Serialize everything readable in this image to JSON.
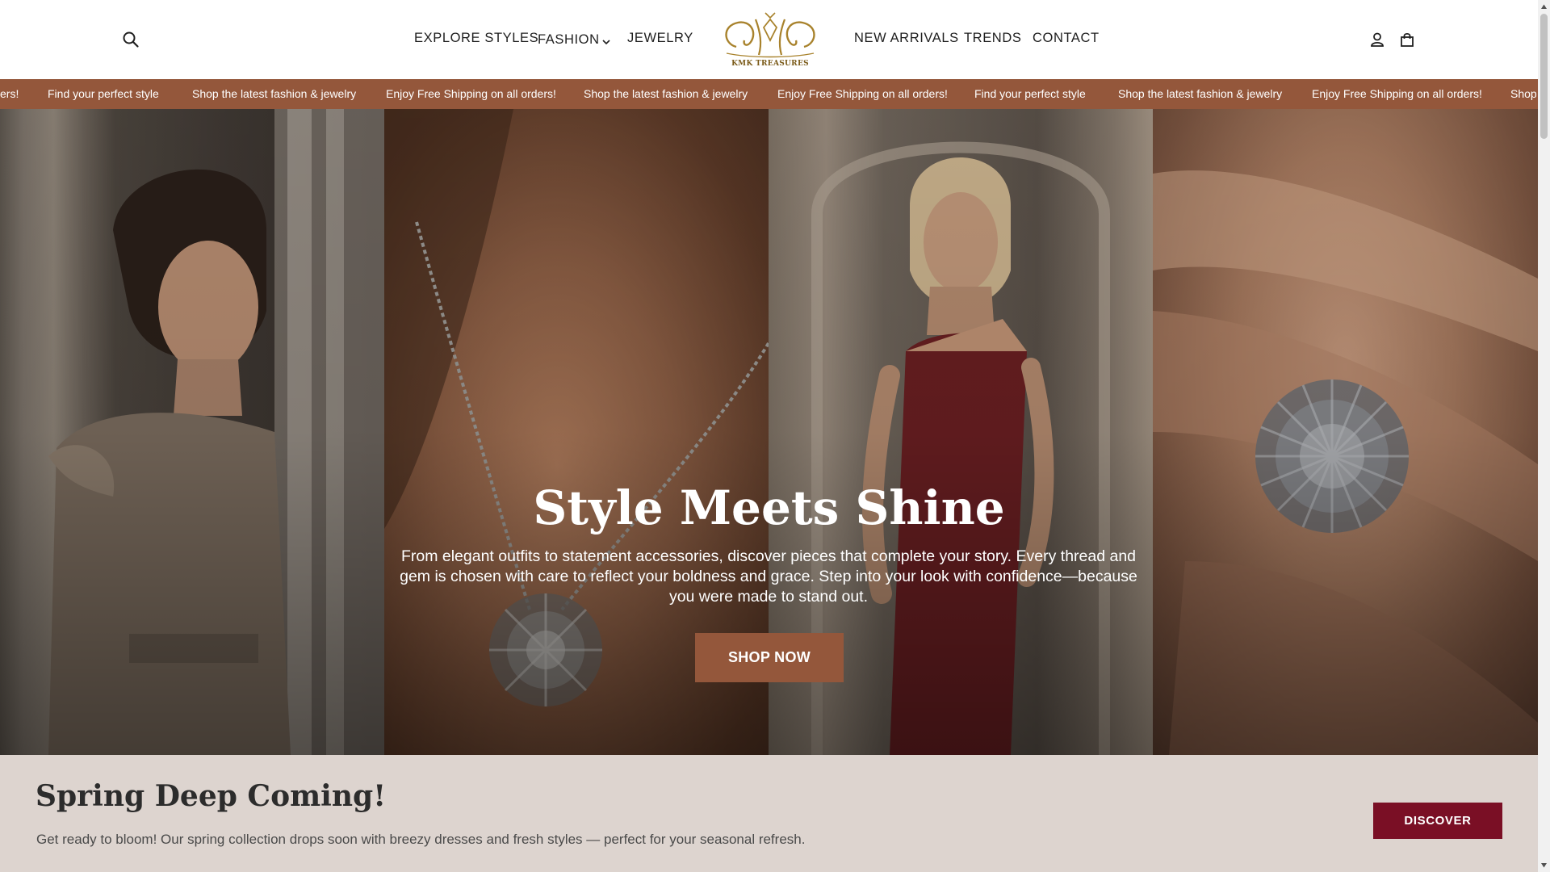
{
  "header": {
    "nav_left": [
      {
        "label": "EXPLORE STYLES"
      },
      {
        "label": "FASHION"
      },
      {
        "label": "JEWELRY"
      }
    ],
    "nav_right": [
      {
        "label": "NEW ARRIVALS"
      },
      {
        "label": "TRENDS"
      },
      {
        "label": "CONTACT"
      }
    ],
    "logo_text": "KMK TREASURES",
    "icons": {
      "search": "search-icon",
      "account": "account-icon",
      "cart": "cart-icon",
      "dropdown": "chevron-down-icon"
    }
  },
  "marquee": {
    "items": [
      "ers!",
      "Find your perfect style",
      "Shop the latest fashion & jewelry",
      "Enjoy Free Shipping on all orders!",
      "Shop the latest fashion & jewelry",
      "Enjoy Free Shipping on all orders!",
      "Find your perfect style",
      "Shop the latest fashion & jewelry",
      "Enjoy Free Shipping on all orders!",
      "Shop"
    ]
  },
  "hero": {
    "title": "Style Meets Shine",
    "text": "From elegant outfits to statement accessories, discover pieces that complete your story. Every thread and gem is chosen with care to reflect your boldness and grace. Step into your look with confidence—because you were made to stand out.",
    "cta": "SHOP NOW"
  },
  "spring": {
    "title": "Spring Deep Coming!",
    "text": "Get ready to bloom! Our spring collection drops soon with breezy dresses and fresh styles — perfect for your seasonal refresh.",
    "cta": "DISCOVER"
  },
  "colors": {
    "accent": "#94573b",
    "discover": "#7a0f25",
    "banner_bg": "#ddd4cf",
    "logo_gold": "#a8822c"
  }
}
